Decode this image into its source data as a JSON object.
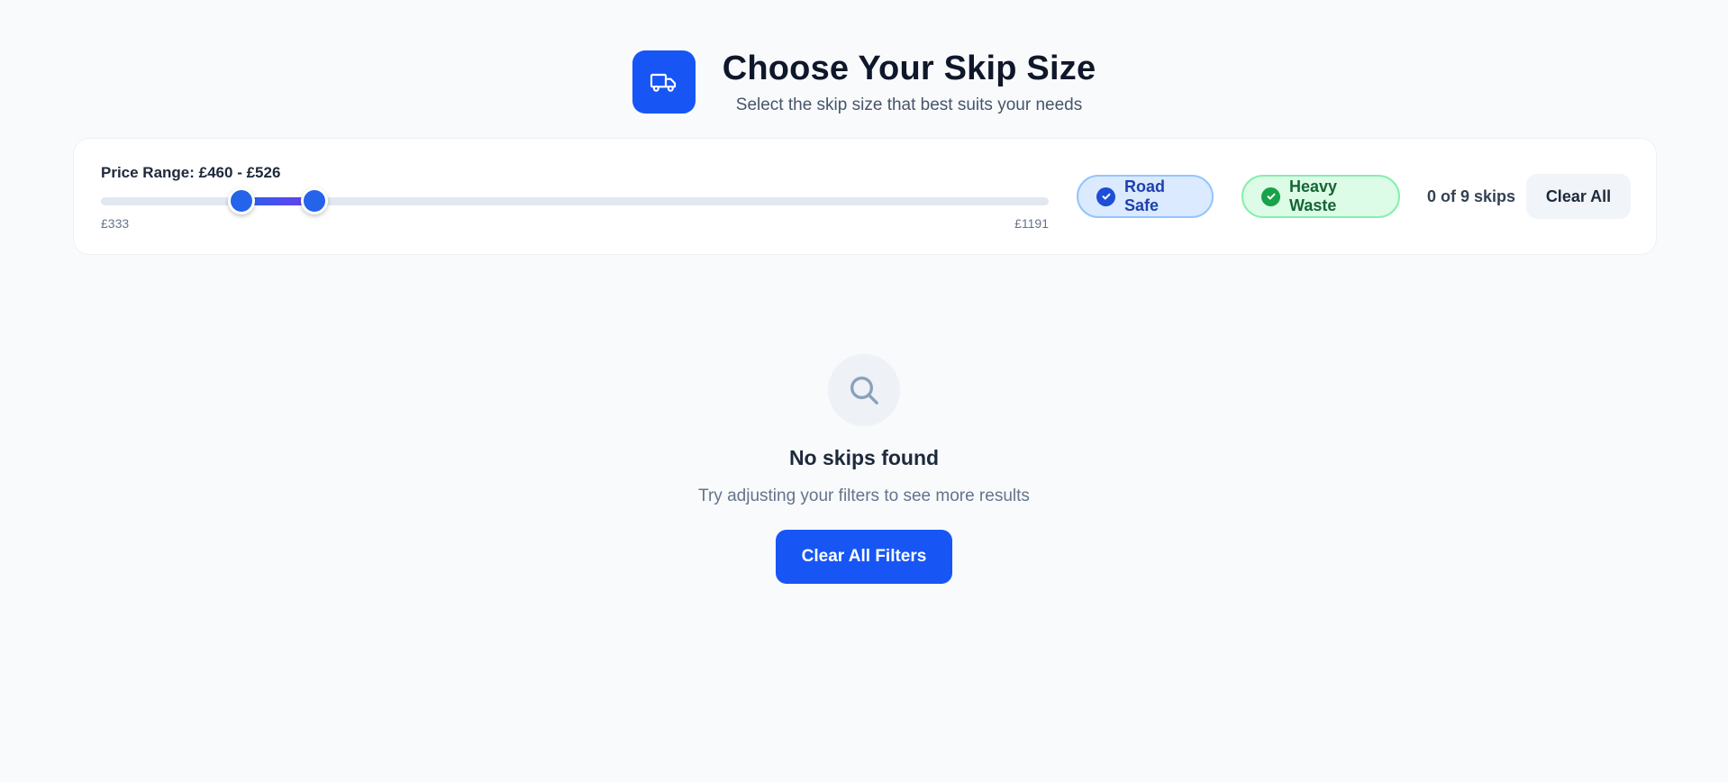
{
  "header": {
    "icon": "truck-icon",
    "title": "Choose Your Skip Size",
    "subtitle": "Select the skip size that best suits your needs"
  },
  "filters": {
    "price_label": "Price Range: £460 - £526",
    "range": {
      "min_label": "£333",
      "max_label": "£1191",
      "min": 333,
      "max": 1191,
      "selected_low": 460,
      "selected_high": 526
    },
    "chips": [
      {
        "label": "Road Safe",
        "icon": "check-circle-icon",
        "active": true,
        "color": "#1d4ed8"
      },
      {
        "label": "Heavy Waste",
        "icon": "check-circle-icon",
        "active": true,
        "color": "#16a34a"
      }
    ],
    "count_text": "0 of 9 skips",
    "clear_label": "Clear All"
  },
  "empty_state": {
    "icon": "search-icon",
    "title": "No skips found",
    "message": "Try adjusting your filters to see more results",
    "button_label": "Clear All Filters"
  },
  "colors": {
    "accent": "#1756f5",
    "background": "#f8fafc"
  }
}
